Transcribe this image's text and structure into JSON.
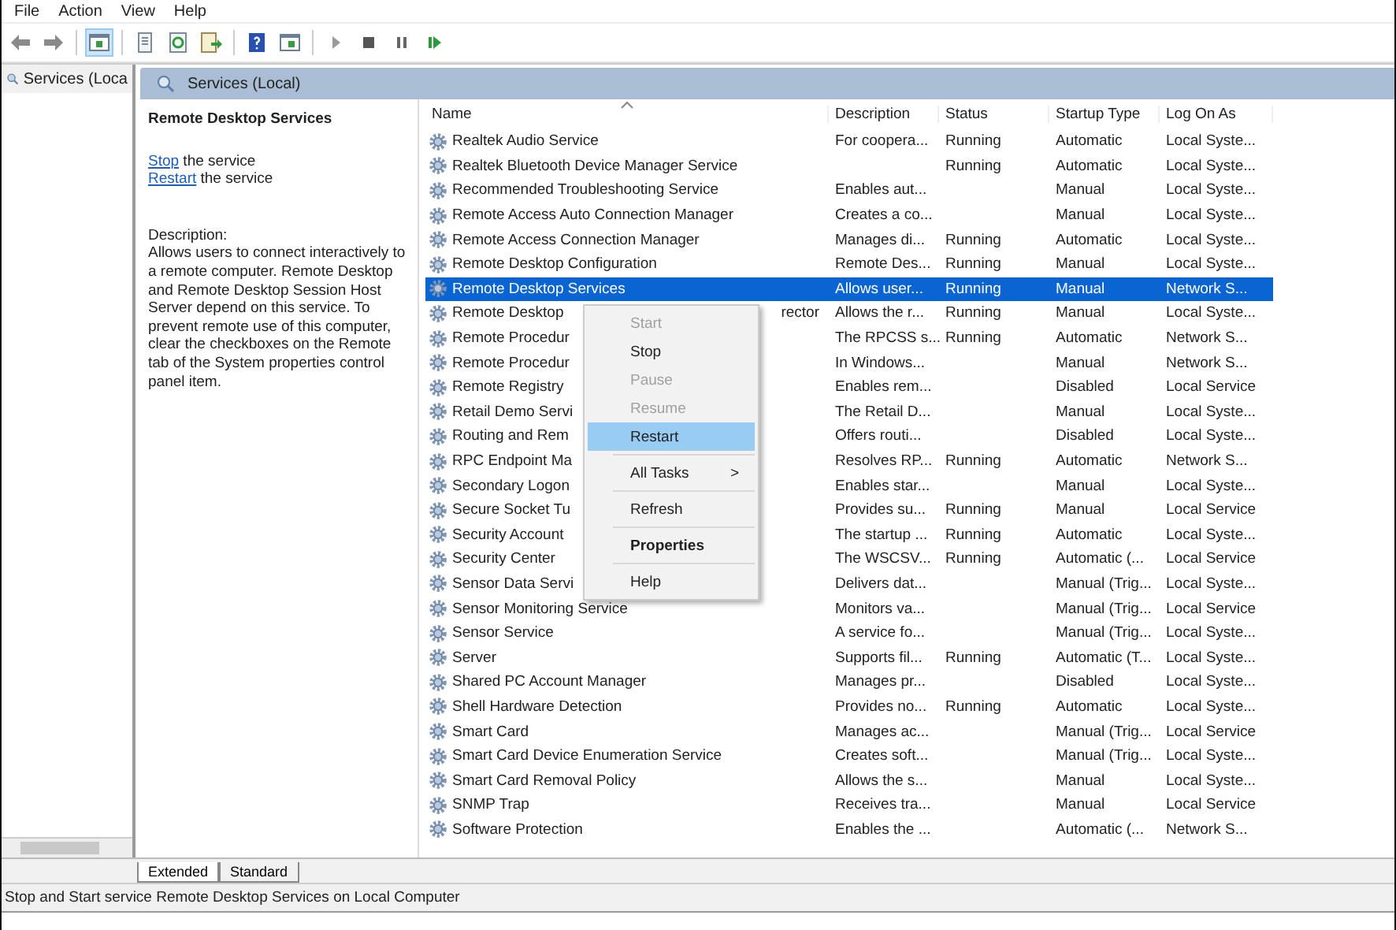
{
  "menubar": [
    "File",
    "Action",
    "View",
    "Help"
  ],
  "toolbar": [
    {
      "buttons": [
        {
          "kind": "back",
          "pressed": false
        },
        {
          "kind": "forward",
          "pressed": false
        }
      ]
    },
    {
      "buttons": [
        {
          "kind": "tree",
          "pressed": true
        }
      ]
    },
    {
      "buttons": [
        {
          "kind": "properties",
          "pressed": false
        },
        {
          "kind": "refresh",
          "pressed": false
        },
        {
          "kind": "export",
          "pressed": false
        }
      ]
    },
    {
      "buttons": [
        {
          "kind": "help",
          "pressed": false
        },
        {
          "kind": "console",
          "pressed": false
        }
      ]
    },
    {
      "buttons": [
        {
          "kind": "start",
          "pressed": false
        },
        {
          "kind": "stop",
          "pressed": false
        },
        {
          "kind": "pause",
          "pressed": false
        },
        {
          "kind": "resume",
          "pressed": false
        }
      ]
    }
  ],
  "tree": {
    "label": "Services (Loca"
  },
  "panel": {
    "title": "Services (Local)"
  },
  "details": {
    "title": "Remote Desktop Services",
    "actions": [
      {
        "link": "Stop",
        "text": " the service"
      },
      {
        "link": "Restart",
        "text": " the service"
      }
    ],
    "description_label": "Description:",
    "description": "Allows users to connect interactively to a remote computer. Remote Desktop and Remote Desktop Session Host Server depend on this service. To prevent remote use of this computer, clear the checkboxes on the Remote tab of the System properties control panel item."
  },
  "table": {
    "columns": [
      "Name",
      "Description",
      "Status",
      "Startup Type",
      "Log On As"
    ],
    "rows": [
      {
        "name": "Realtek Audio Service",
        "description": "For coopera...",
        "status": "Running",
        "startup": "Automatic",
        "logon": "Local Syste...",
        "selected": false
      },
      {
        "name": "Realtek Bluetooth Device Manager Service",
        "status": "Running",
        "startup": "Automatic",
        "logon": "Local Syste...",
        "selected": false
      },
      {
        "name": "Recommended Troubleshooting Service",
        "description": "Enables aut...",
        "startup": "Manual",
        "logon": "Local Syste...",
        "selected": false
      },
      {
        "name": "Remote Access Auto Connection Manager",
        "description": "Creates a co...",
        "startup": "Manual",
        "logon": "Local Syste...",
        "selected": false
      },
      {
        "name": "Remote Access Connection Manager",
        "description": "Manages di...",
        "status": "Running",
        "startup": "Automatic",
        "logon": "Local Syste...",
        "selected": false
      },
      {
        "name": "Remote Desktop Configuration",
        "description": "Remote Des...",
        "status": "Running",
        "startup": "Manual",
        "logon": "Local Syste...",
        "selected": false
      },
      {
        "name": "Remote Desktop Services",
        "description": "Allows user...",
        "status": "Running",
        "startup": "Manual",
        "logon": "Network S...",
        "selected": true
      },
      {
        "name": "Remote Desktop",
        "name_tail": "rector",
        "description": "Allows the r...",
        "status": "Running",
        "startup": "Manual",
        "logon": "Local Syste...",
        "selected": false
      },
      {
        "name": "Remote Procedur",
        "description": "The RPCSS s...",
        "status": "Running",
        "startup": "Automatic",
        "logon": "Network S...",
        "selected": false
      },
      {
        "name": "Remote Procedur",
        "description": "In Windows...",
        "startup": "Manual",
        "logon": "Network S...",
        "selected": false
      },
      {
        "name": "Remote Registry",
        "description": "Enables rem...",
        "startup": "Disabled",
        "logon": "Local Service",
        "selected": false
      },
      {
        "name": "Retail Demo Servi",
        "description": "The Retail D...",
        "startup": "Manual",
        "logon": "Local Syste...",
        "selected": false
      },
      {
        "name": "Routing and Rem",
        "description": "Offers routi...",
        "startup": "Disabled",
        "logon": "Local Syste...",
        "selected": false
      },
      {
        "name": "RPC Endpoint Ma",
        "description": "Resolves RP...",
        "status": "Running",
        "startup": "Automatic",
        "logon": "Network S...",
        "selected": false
      },
      {
        "name": "Secondary Logon",
        "description": "Enables star...",
        "startup": "Manual",
        "logon": "Local Syste...",
        "selected": false
      },
      {
        "name": "Secure Socket Tu",
        "description": "Provides su...",
        "status": "Running",
        "startup": "Manual",
        "logon": "Local Service",
        "selected": false
      },
      {
        "name": "Security Account",
        "description": "The startup ...",
        "status": "Running",
        "startup": "Automatic",
        "logon": "Local Syste...",
        "selected": false
      },
      {
        "name": "Security Center",
        "description": "The WSCSV...",
        "status": "Running",
        "startup": "Automatic (...",
        "logon": "Local Service",
        "selected": false
      },
      {
        "name": "Sensor Data Servi",
        "description": "Delivers dat...",
        "startup": "Manual (Trig...",
        "logon": "Local Syste...",
        "selected": false
      },
      {
        "name": "Sensor Monitoring Service",
        "description": "Monitors va...",
        "startup": "Manual (Trig...",
        "logon": "Local Service",
        "selected": false
      },
      {
        "name": "Sensor Service",
        "description": "A service fo...",
        "startup": "Manual (Trig...",
        "logon": "Local Syste...",
        "selected": false
      },
      {
        "name": "Server",
        "description": "Supports fil...",
        "status": "Running",
        "startup": "Automatic (T...",
        "logon": "Local Syste...",
        "selected": false
      },
      {
        "name": "Shared PC Account Manager",
        "description": "Manages pr...",
        "startup": "Disabled",
        "logon": "Local Syste...",
        "selected": false
      },
      {
        "name": "Shell Hardware Detection",
        "description": "Provides no...",
        "status": "Running",
        "startup": "Automatic",
        "logon": "Local Syste...",
        "selected": false
      },
      {
        "name": "Smart Card",
        "description": "Manages ac...",
        "startup": "Manual (Trig...",
        "logon": "Local Service",
        "selected": false
      },
      {
        "name": "Smart Card Device Enumeration Service",
        "description": "Creates soft...",
        "startup": "Manual (Trig...",
        "logon": "Local Syste...",
        "selected": false
      },
      {
        "name": "Smart Card Removal Policy",
        "description": "Allows the s...",
        "startup": "Manual",
        "logon": "Local Syste...",
        "selected": false
      },
      {
        "name": "SNMP Trap",
        "description": "Receives tra...",
        "startup": "Manual",
        "logon": "Local Service",
        "selected": false
      },
      {
        "name": "Software Protection",
        "description": "Enables the ...",
        "startup": "Automatic (...",
        "logon": "Network S...",
        "selected": false
      }
    ]
  },
  "context_menu": [
    {
      "kind": "item",
      "label": "Start",
      "disabled": true,
      "selected": false
    },
    {
      "kind": "item",
      "label": "Stop",
      "disabled": false,
      "selected": false
    },
    {
      "kind": "item",
      "label": "Pause",
      "disabled": true,
      "selected": false
    },
    {
      "kind": "item",
      "label": "Resume",
      "disabled": true,
      "selected": false
    },
    {
      "kind": "item",
      "label": "Restart",
      "disabled": false,
      "selected": true
    },
    {
      "kind": "separator"
    },
    {
      "kind": "submenu",
      "label": "All Tasks",
      "arrow": ">",
      "disabled": false,
      "selected": false
    },
    {
      "kind": "separator"
    },
    {
      "kind": "item",
      "label": "Refresh",
      "disabled": false,
      "selected": false
    },
    {
      "kind": "separator"
    },
    {
      "kind": "default",
      "label": "Properties",
      "disabled": false,
      "selected": false
    },
    {
      "kind": "separator"
    },
    {
      "kind": "item",
      "label": "Help",
      "disabled": false,
      "selected": false
    }
  ],
  "view_tabs": [
    {
      "label": "Extended",
      "selected": true
    },
    {
      "label": "Standard",
      "selected": false
    }
  ],
  "status_bar": "Stop and Start service Remote Desktop Services on Local Computer"
}
